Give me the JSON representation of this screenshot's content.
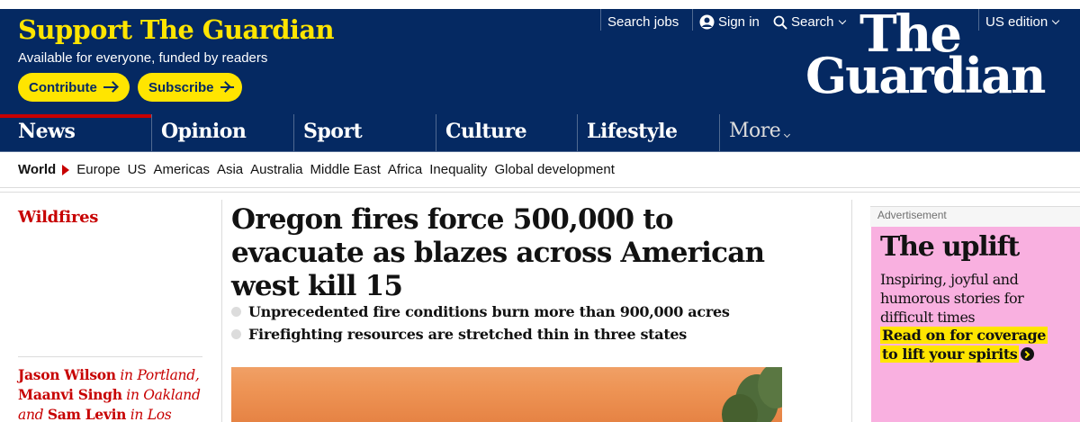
{
  "header": {
    "support_title": "Support The Guardian",
    "support_subtitle": "Available for everyone, funded by readers",
    "contribute_label": "Contribute",
    "subscribe_label": "Subscribe",
    "logo_line1": "The",
    "logo_line2": "Guardian",
    "top_links": {
      "search_jobs": "Search jobs",
      "sign_in": "Sign in",
      "search": "Search",
      "edition": "US edition"
    }
  },
  "pillars": [
    "News",
    "Opinion",
    "Sport",
    "Culture",
    "Lifestyle",
    "More"
  ],
  "subnav": {
    "current": "World",
    "items": [
      "Europe",
      "US",
      "Americas",
      "Asia",
      "Australia",
      "Middle East",
      "Africa",
      "Inequality",
      "Global development"
    ]
  },
  "article": {
    "section": "Wildfires",
    "headline": "Oregon fires force 500,000 to evacuate as blazes across American west kill 15",
    "standfirst": [
      "Unprecedented fire conditions burn more than 900,000 acres",
      "Firefighting resources are stretched thin in three states"
    ],
    "byline": {
      "author1": "Jason Wilson",
      "loc1": " in Portland,",
      "author2": "Maanvi Singh",
      "loc2": " in Oakland",
      "and": "and ",
      "author3": "Sam Levin",
      "loc3": " in Los"
    }
  },
  "ad": {
    "label": "Advertisement",
    "title": "The uplift",
    "body": "Inspiring, joyful and humorous stories for difficult times",
    "cta": "Read on for coverage to lift your spirits"
  },
  "colors": {
    "brand_blue": "#052962",
    "brand_yellow": "#ffe500",
    "news_red": "#c70000",
    "ad_pink": "#f9b0e0"
  }
}
